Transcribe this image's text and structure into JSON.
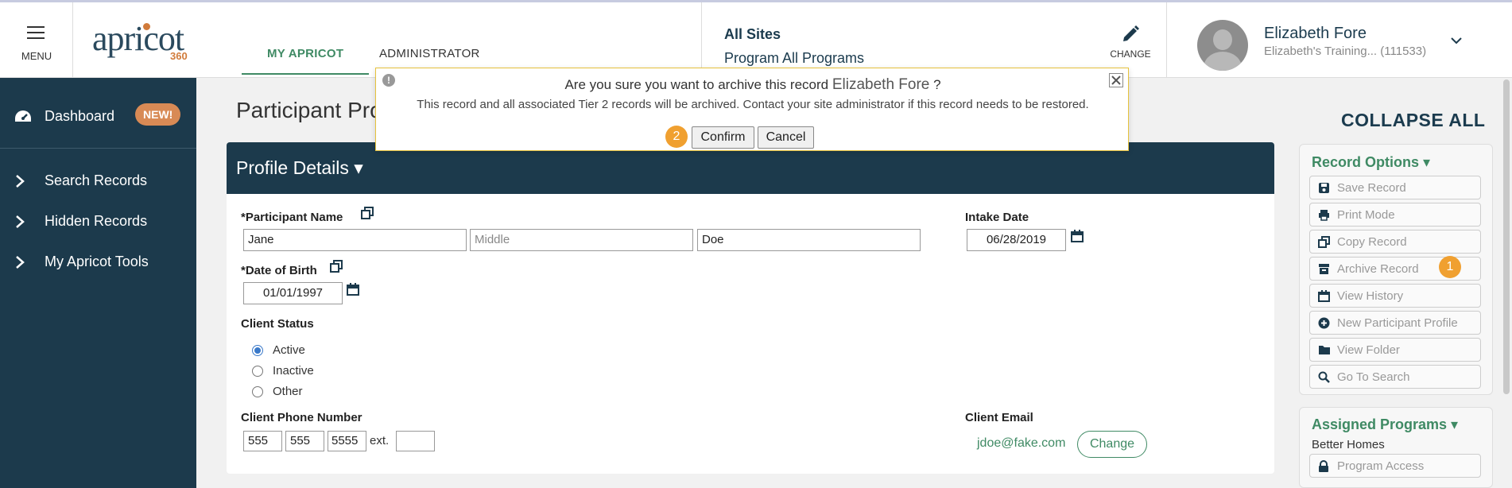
{
  "header": {
    "menu_label": "MENU",
    "logo_text": "apricot",
    "logo_sub": "360",
    "tabs": [
      {
        "label": "MY APRICOT",
        "active": true
      },
      {
        "label": "ADMINISTRATOR",
        "active": false
      }
    ],
    "site": "All Sites",
    "program": "Program All Programs",
    "change_label": "CHANGE",
    "user_name": "Elizabeth Fore",
    "user_sub": "Elizabeth's Training...  (111533)"
  },
  "sidebar": {
    "items": [
      {
        "label": "Dashboard",
        "badge": "NEW!",
        "icon": "dashboard-icon"
      },
      {
        "label": "Search Records",
        "icon": "chevron-right-icon"
      },
      {
        "label": "Hidden Records",
        "icon": "chevron-right-icon"
      },
      {
        "label": "My Apricot Tools",
        "icon": "chevron-right-icon"
      }
    ]
  },
  "page": {
    "title": "Participant Pro",
    "panel_title": "Profile Details ▾"
  },
  "form": {
    "participant_name_label": "*Participant Name",
    "first_name": "Jane",
    "middle_placeholder": "Middle",
    "last_name": "Doe",
    "intake_label": "Intake Date",
    "intake_date": "06/28/2019",
    "dob_label": "*Date of Birth",
    "dob": "01/01/1997",
    "status_label": "Client Status",
    "status_options": [
      {
        "label": "Active",
        "selected": true
      },
      {
        "label": "Inactive",
        "selected": false
      },
      {
        "label": "Other",
        "selected": false
      }
    ],
    "phone_label": "Client Phone Number",
    "phone_area": "555",
    "phone_prefix": "555",
    "phone_line": "5555",
    "ext_label": "ext.",
    "ext_value": "",
    "email_label": "Client Email",
    "email_value": "jdoe@fake.com",
    "email_change": "Change"
  },
  "right_panel": {
    "collapse_all": "COLLAPSE ALL",
    "record_options_title": "Record Options ▾",
    "options": [
      {
        "label": "Save Record",
        "icon": "save-icon"
      },
      {
        "label": "Print Mode",
        "icon": "print-icon"
      },
      {
        "label": "Copy Record",
        "icon": "copy-icon"
      },
      {
        "label": "Archive Record",
        "icon": "archive-icon"
      },
      {
        "label": "View History",
        "icon": "calendar-icon"
      },
      {
        "label": "New Participant Profile",
        "icon": "plus-circle-icon"
      },
      {
        "label": "View Folder",
        "icon": "folder-icon"
      },
      {
        "label": "Go To Search",
        "icon": "search-icon"
      }
    ],
    "assigned_title": "Assigned Programs ▾",
    "assigned_program": "Better Homes",
    "program_access": "Program Access"
  },
  "dialog": {
    "question_prefix": "Are you sure you want to archive this record",
    "record_name": "Elizabeth Fore",
    "question_suffix": "?",
    "message": "This record and all associated Tier 2 records will be archived. Contact your site administrator if this record needs to be restored.",
    "confirm": "Confirm",
    "cancel": "Cancel"
  },
  "steps": {
    "one": "1",
    "two": "2"
  },
  "colors": {
    "navy": "#1c3a4c",
    "green": "#3f8a64",
    "orange": "#f0a030",
    "badge": "#d88a55"
  }
}
